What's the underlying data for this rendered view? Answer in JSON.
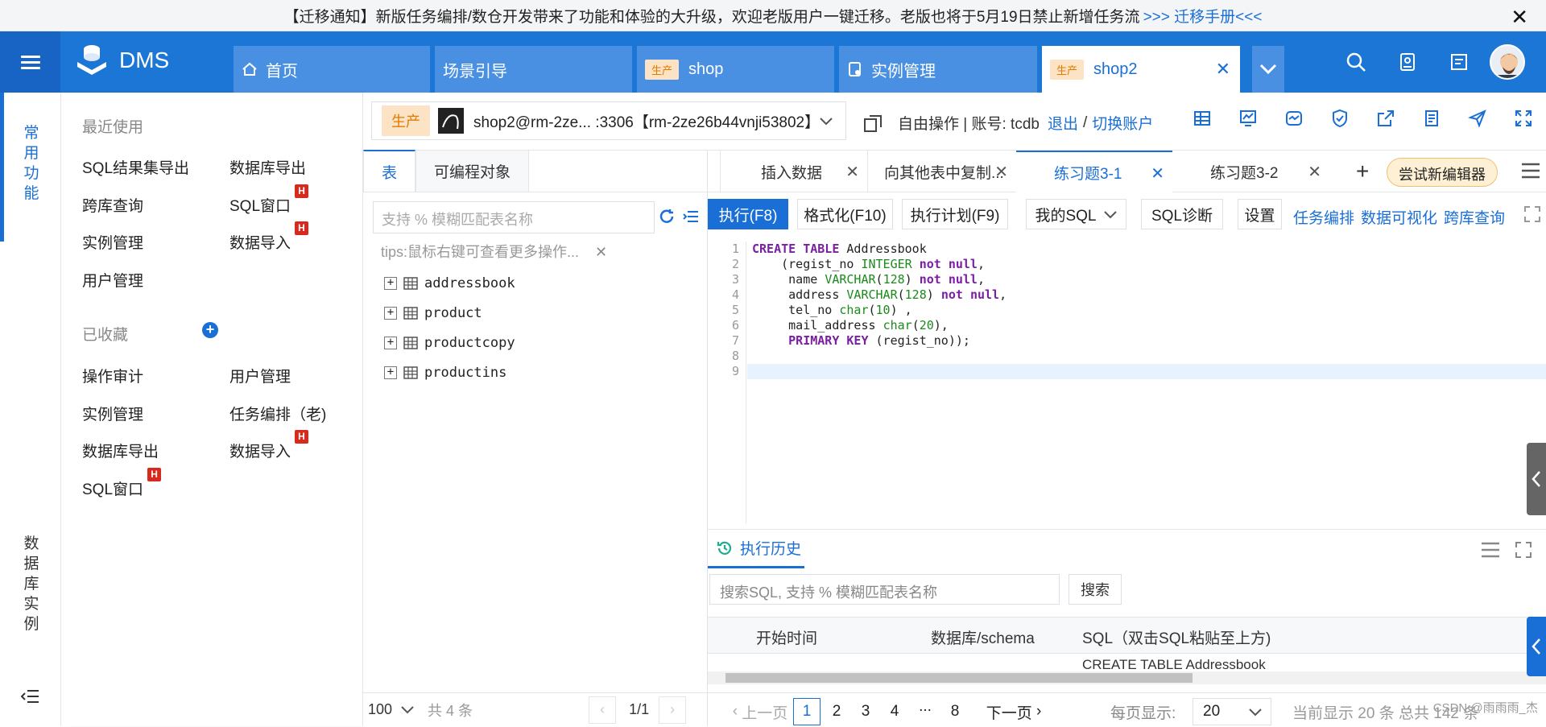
{
  "notice": {
    "text": "【迁移通知】新版任务编排/数仓开发带来了功能和体验的大升级，欢迎老版用户一键迁移。老版也将于5月19日禁止新增任务流",
    "link": ">>> 迁移手册<<<",
    "close": "✕"
  },
  "topnav": {
    "logo": "DMS",
    "tabs": [
      {
        "label": "首页",
        "icon": "home-icon"
      },
      {
        "label": "场景引导"
      },
      {
        "label": "shop",
        "tag": "生产"
      },
      {
        "label": "实例管理",
        "icon": "instance-icon"
      },
      {
        "label": "shop2",
        "tag": "生产",
        "active": true
      }
    ]
  },
  "rail": {
    "common": "常用功能",
    "dbinstance": "数据库实例"
  },
  "menu": {
    "recent_title": "最近使用",
    "recent": [
      "SQL结果集导出",
      "数据库导出",
      "跨库查询",
      "SQL窗口",
      "实例管理",
      "数据导入",
      "用户管理"
    ],
    "fav_title": "已收藏",
    "favorites": [
      "操作审计",
      "用户管理",
      "实例管理",
      "任务编排（老)",
      "数据库导出",
      "数据导入",
      "SQL窗口"
    ],
    "badge": "H"
  },
  "dbbar": {
    "env": "生产",
    "conn": "shop2@rm-2ze... :3306【rm-2ze26b44vnji53802】",
    "mode": "自由操作 | 账号: tcdb",
    "logout": "退出",
    "sep": "/",
    "switch": "切换账户"
  },
  "tree": {
    "tabs": [
      "表",
      "可编程对象"
    ],
    "search_placeholder": "支持 % 模糊匹配表名称",
    "tips": "tips:鼠标右键可查看更多操作...",
    "tables": [
      "addressbook",
      "product",
      "productcopy",
      "productins"
    ],
    "page_size": "100",
    "total": "共 4 条",
    "page": "1/1"
  },
  "editor": {
    "tabs": [
      "插入数据",
      "向其他表中复制...",
      "练习题3-1",
      "练习题3-2"
    ],
    "new_editor": "尝试新编辑器",
    "buttons": [
      "执行(F8)",
      "格式化(F10)",
      "执行计划(F9)",
      "我的SQL",
      "SQL诊断",
      "设置"
    ],
    "links": [
      "任务编排",
      "数据可视化",
      "跨库查询"
    ],
    "line_numbers": [
      "1",
      "2",
      "3",
      "4",
      "5",
      "6",
      "7",
      "8",
      "9"
    ]
  },
  "history": {
    "title": "执行历史",
    "search_placeholder": "搜索SQL, 支持 % 模糊匹配表名称",
    "search_btn": "搜索",
    "columns": [
      "开始时间",
      "数据库/schema",
      "SQL（双击SQL粘贴至上方)"
    ],
    "row_sql": "CREATE TABLE Addressbook",
    "pager": {
      "prev": "上一页",
      "pages": [
        "1",
        "2",
        "3",
        "4",
        "...",
        "8"
      ],
      "next": "下一页",
      "per_page_label": "每页显示:",
      "per_page": "20",
      "summary": "当前显示 20 条 总共 142 条"
    }
  },
  "watermark": "CSDN @雨雨雨_杰"
}
